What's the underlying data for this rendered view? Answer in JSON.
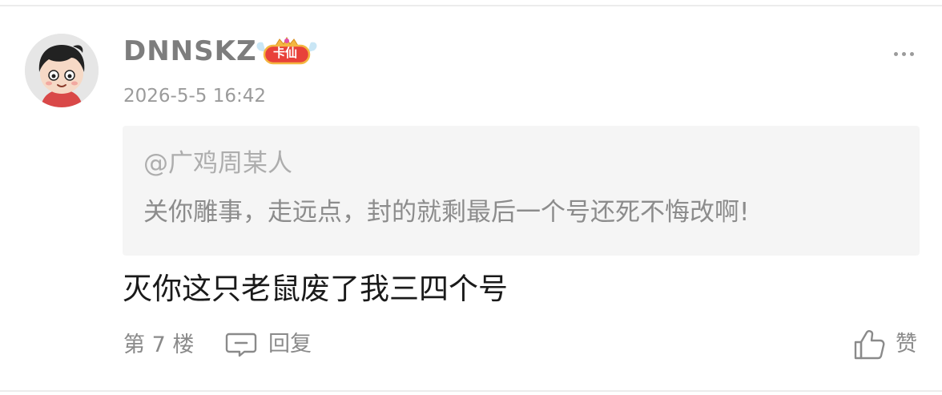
{
  "comment": {
    "username": "DNNSKZ",
    "badge_label": "卡仙",
    "timestamp": "2026-5-5 16:42",
    "quote": {
      "user": "@广鸡周某人",
      "text": "关你雕事，走远点，封的就剩最后一个号还死不悔改啊!"
    },
    "body": "灭你这只老鼠废了我三四个号",
    "floor": "第 7 楼",
    "reply_label": "回复",
    "like_label": "赞"
  },
  "icons": {
    "avatar": "cartoon-avatar",
    "badge": "crown-badge-icon",
    "more": "more-dots-icon",
    "reply": "comment-bubble-icon",
    "like": "thumbs-up-icon"
  },
  "colors": {
    "username": "#7d7d7d",
    "meta_text": "#9b9b9b",
    "quote_bg": "#f5f5f5",
    "body_text": "#1a1a1a",
    "badge_red": "#e8413a",
    "badge_gold": "#f4b640"
  }
}
